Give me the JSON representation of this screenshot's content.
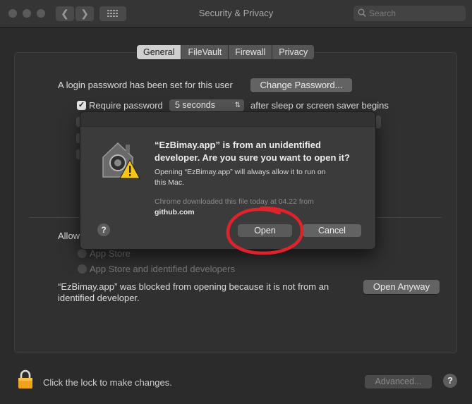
{
  "window": {
    "title": "Security & Privacy",
    "search_placeholder": "Search"
  },
  "tabs": [
    "General",
    "FileVault",
    "Firewall",
    "Privacy"
  ],
  "active_tab": "General",
  "general": {
    "login_password_text": "A login password has been set for this user",
    "change_password_label": "Change Password...",
    "require_password_label": "Require password",
    "require_password_value": "5 seconds",
    "after_sleep_text": "after sleep or screen saver begins",
    "allow_prefix": "Allow",
    "radio_app_store": "App Store",
    "radio_app_store_identified": "App Store and identified developers",
    "blocked_text_line1": "“EzBimay.app” was blocked from opening because it is not from an",
    "blocked_text_line2": "identified developer.",
    "open_anyway_label": "Open Anyway"
  },
  "footer": {
    "lock_text": "Click the lock to make changes.",
    "advanced_label": "Advanced..."
  },
  "dialog": {
    "title_line1": "“EzBimay.app” is from an unidentified",
    "title_line2": "developer. Are you sure you want to open it?",
    "body_line1": "Opening “EzBimay.app” will always allow it to run on",
    "body_line2": "this Mac.",
    "source_line1": "Chrome downloaded this file today at 04.22 from",
    "source_domain": "github.com",
    "open_label": "Open",
    "cancel_label": "Cancel",
    "help_label": "?"
  },
  "help_label": "?",
  "colors": {
    "annotation_circle": "#e0232b",
    "warning_yellow": "#f5c518"
  }
}
